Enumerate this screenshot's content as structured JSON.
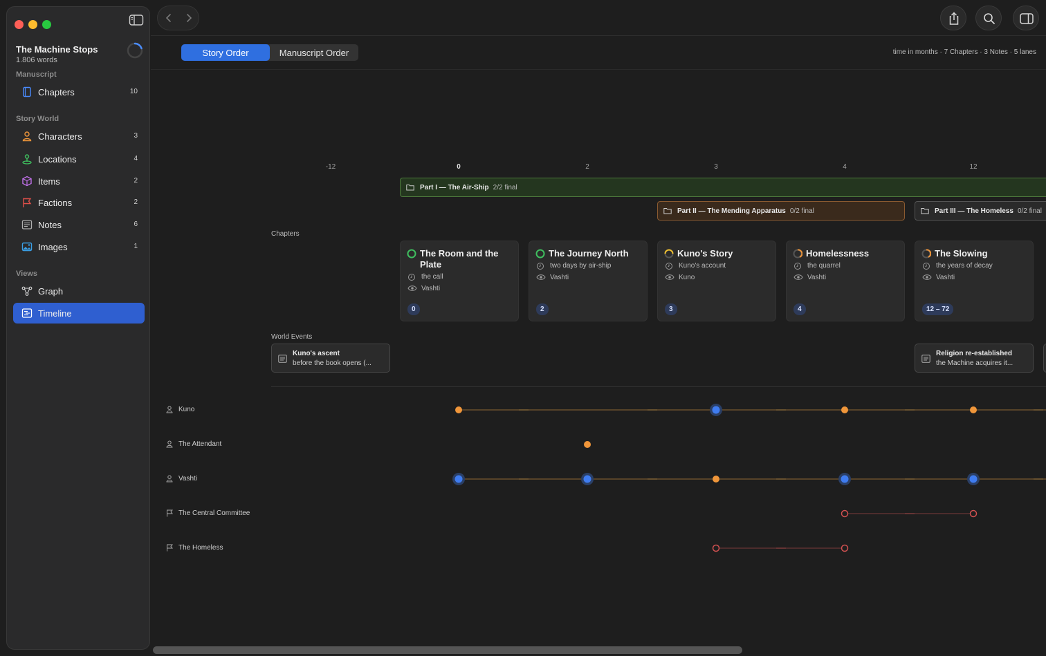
{
  "window": {
    "traffic_lights": {
      "close": "#fe5f57",
      "minimize": "#febc2e",
      "zoom": "#28c840"
    }
  },
  "project": {
    "title": "The Machine Stops",
    "words": "1.806 words"
  },
  "sidebar": {
    "sections": {
      "manuscript": "Manuscript",
      "story_world": "Story World",
      "views": "Views"
    },
    "items": [
      {
        "label": "Chapters",
        "count": "10",
        "icon": "book-icon",
        "color": "#4a8cff"
      },
      {
        "label": "Characters",
        "count": "3",
        "icon": "person-icon",
        "color": "#f0963a"
      },
      {
        "label": "Locations",
        "count": "4",
        "icon": "pin-icon",
        "color": "#3fbf5f"
      },
      {
        "label": "Items",
        "count": "2",
        "icon": "cube-icon",
        "color": "#c070e8"
      },
      {
        "label": "Factions",
        "count": "2",
        "icon": "flag-icon",
        "color": "#e0504a"
      },
      {
        "label": "Notes",
        "count": "6",
        "icon": "note-icon",
        "color": "#b0b0b0"
      },
      {
        "label": "Images",
        "count": "1",
        "icon": "image-icon",
        "color": "#3aa0e8"
      },
      {
        "label": "Graph",
        "icon": "graph-icon",
        "color": "#d0d0d0"
      },
      {
        "label": "Timeline",
        "icon": "timeline-icon",
        "color": "#ffffff",
        "active": true
      }
    ]
  },
  "toolbar": {
    "segments": [
      "Story Order",
      "Manuscript Order"
    ],
    "active_segment": "Story Order",
    "meta": "time in months · 7 Chapters · 3 Notes · 5 lanes"
  },
  "timeline": {
    "ticks": [
      "-12",
      "0",
      "2",
      "3",
      "4",
      "12"
    ],
    "parts": [
      {
        "name": "Part I — The Air-Ship",
        "status": "2/2 final",
        "color": "#3fbf5f"
      },
      {
        "name": "Part II — The Mending Apparatus",
        "status": "0/2 final",
        "color": "#f0963a"
      },
      {
        "name": "Part III — The Homeless",
        "status": "0/2 final",
        "color": "#8c8c8c"
      }
    ],
    "lanes": {
      "chapters": "Chapters",
      "world_events": "World Events"
    },
    "chapters": [
      {
        "title": "The Room and the Plate",
        "summary": "the call",
        "pov": "Vashti",
        "time": "0",
        "status": "final"
      },
      {
        "title": "The Journey North",
        "summary": "two days by air-ship",
        "pov": "Vashti",
        "time": "2",
        "status": "final"
      },
      {
        "title": "Kuno's Story",
        "summary": "Kuno's account",
        "pov": "Kuno",
        "time": "3",
        "status": "revised"
      },
      {
        "title": "Homelessness",
        "summary": "the quarrel",
        "pov": "Vashti",
        "time": "4",
        "status": "draft"
      },
      {
        "title": "The Slowing",
        "summary": "the years of decay",
        "pov": "Vashti",
        "time": "12 – 72",
        "status": "draft"
      }
    ],
    "events": [
      {
        "title": "Kuno's ascent",
        "summary": "before the book opens (..."
      },
      {
        "title": "Religion re-established",
        "summary": "the Machine acquires it..."
      }
    ],
    "rows": [
      {
        "label": "Kuno",
        "kind": "character",
        "icon": "person-icon"
      },
      {
        "label": "The Attendant",
        "kind": "character",
        "icon": "person-icon"
      },
      {
        "label": "Vashti",
        "kind": "character",
        "icon": "person-icon"
      },
      {
        "label": "The Central Committee",
        "kind": "faction",
        "icon": "flag-icon"
      },
      {
        "label": "The Homeless",
        "kind": "faction",
        "icon": "flag-icon"
      }
    ]
  }
}
